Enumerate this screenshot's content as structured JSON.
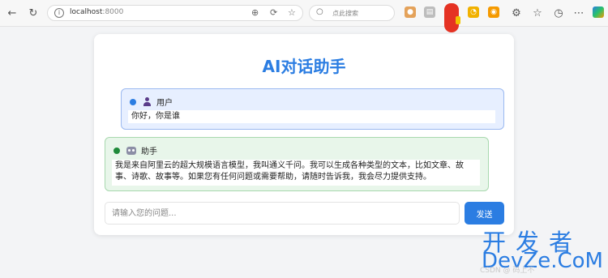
{
  "browser": {
    "url_host": "localhost",
    "url_port": ":8000",
    "search_placeholder": "点此搜索",
    "info_glyph": "i"
  },
  "app": {
    "title": "AI对话助手",
    "accent_color": "#2b7de2"
  },
  "messages": [
    {
      "role": "user",
      "sender": "用户",
      "text": "你好，你是谁"
    },
    {
      "role": "assistant",
      "sender": "助手",
      "text": "我是来自阿里云的超大规模语言模型，我叫通义千问。我可以生成各种类型的文本，比如文章、故事、诗歌、故事等。如果您有任何问题或需要帮助，请随时告诉我，我会尽力提供支持。"
    }
  ],
  "input": {
    "placeholder": "请输入您的问题...",
    "value": ""
  },
  "send_button_label": "发送",
  "watermark": {
    "line1": "开发者",
    "line2": "DevZe.CoM",
    "faint": "CSDN @ 码上不"
  }
}
